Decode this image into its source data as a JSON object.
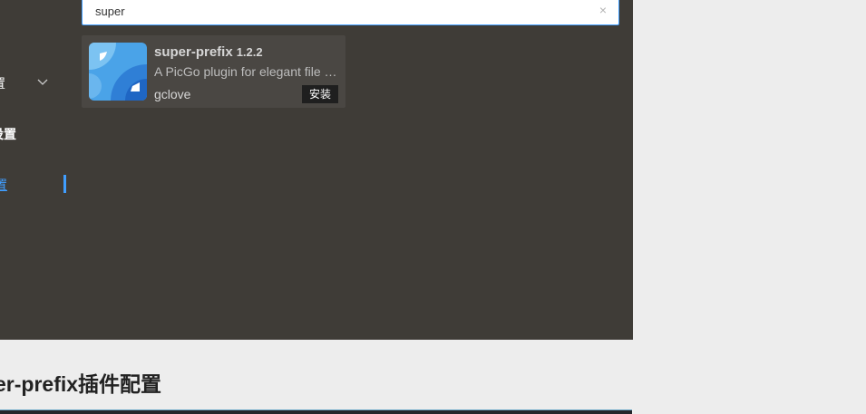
{
  "sidebar": {
    "items": [
      {
        "label": "置"
      },
      {
        "label": "设置"
      },
      {
        "label": "置"
      }
    ]
  },
  "search": {
    "value": "super",
    "clear_symbol": "×"
  },
  "plugin": {
    "name": "super-prefix",
    "version": "1.2.2",
    "description": "A PicGo plugin for elegant file …",
    "author": "gclove",
    "install_label": "安装"
  },
  "content": {
    "heading": "er-prefix插件配置"
  },
  "colors": {
    "app_background": "#3f3c37",
    "accent": "#409eff",
    "card_background": "#4a4743",
    "page_background": "#ededed"
  }
}
